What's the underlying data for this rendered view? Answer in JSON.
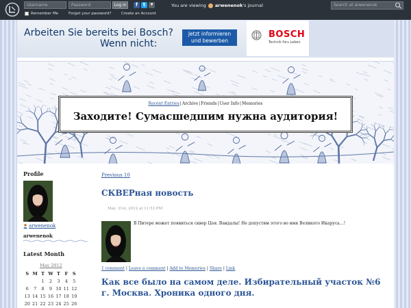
{
  "topbar": {
    "username_placeholder": "Username",
    "password_placeholder": "Password",
    "login_label": "Log in",
    "remember_label": "Remember Me",
    "forgot_label": "Forgot your password?",
    "create_label": "Create an Account",
    "viewing_prefix": "You are viewing",
    "viewing_user": "arwenenok",
    "viewing_suffix": "'s journal",
    "search_placeholder": "Search at arwenenok",
    "facebook_icon": "f",
    "twitter_icon": "t"
  },
  "ad": {
    "question_line1": "Arbeiten Sie bereits bei Bosch?",
    "question_line2": "Wenn nicht:",
    "cta_line1": "Jetzt informieren",
    "cta_line2": "und bewerben",
    "brand": "BOSCH",
    "tagline": "Technik fürs Leben"
  },
  "header": {
    "nav": [
      "Recent Entries",
      "Archive",
      "Friends",
      "User Info",
      "Memories"
    ],
    "title": "Заходите! Сумасшедшим нужна аудитория!"
  },
  "sidebar": {
    "profile_heading": "Profile",
    "user_link": "arwenenok",
    "user_name": "arwenenok",
    "latest_month_heading": "Latest Month",
    "calendar_month": "May 2012",
    "weekdays": [
      "S",
      "M",
      "T",
      "W",
      "T",
      "F",
      "S"
    ],
    "calendar_rows": [
      [
        "",
        "",
        "1",
        "2",
        "3",
        "4",
        "5"
      ],
      [
        "6",
        "7",
        "8",
        "9",
        "10",
        "11",
        "12"
      ],
      [
        "13",
        "14",
        "15",
        "16",
        "17",
        "18",
        "19"
      ],
      [
        "20",
        "21",
        "22",
        "23",
        "24",
        "25",
        "26"
      ]
    ]
  },
  "main": {
    "previous_label": "Previous 10",
    "entries": [
      {
        "title": "СКВЕРная новость",
        "date": "May. 31st, 2012 at 11:53 PM",
        "text": "В Питере может появиться сквер Цоя. Вандалы! Не допустим этого во имя Великого Икаруса…!",
        "links": [
          "1 comment",
          "Leave a comment",
          "Add to Memories",
          "Share",
          "Link"
        ]
      },
      {
        "title": "Как все было на самом деле. Избирательный участок №6 г. Москва. Хроника одного дня."
      }
    ]
  },
  "colors": {
    "topbar_bg": "#2c3239",
    "link_blue": "#2b5595",
    "bosch_red": "#e20015",
    "ad_button": "#1c5aa8"
  }
}
